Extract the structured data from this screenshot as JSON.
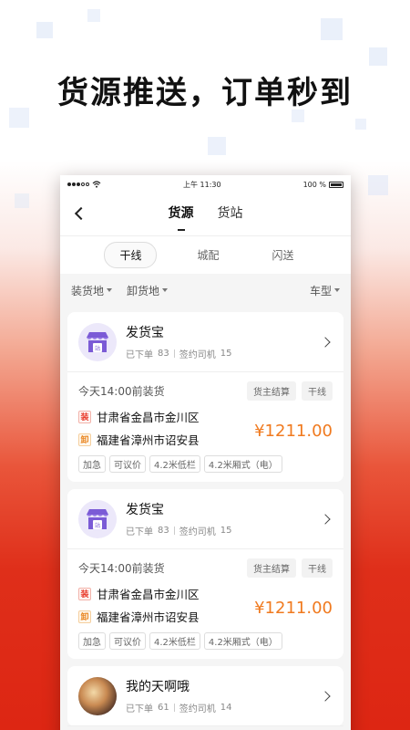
{
  "headline": "货源推送，订单秒到",
  "status_bar": {
    "time": "上午 11:30",
    "battery": "100 %"
  },
  "nav": {
    "tabs": [
      {
        "label": "货源",
        "active": true
      },
      {
        "label": "货站",
        "active": false
      }
    ]
  },
  "sub_tabs": [
    {
      "label": "干线",
      "active": true
    },
    {
      "label": "城配",
      "active": false
    },
    {
      "label": "闪送",
      "active": false
    }
  ],
  "filters": {
    "load_place": "装货地",
    "unload_place": "卸货地",
    "vehicle_type": "车型"
  },
  "cards": [
    {
      "name": "发货宝",
      "orders_label": "已下单",
      "orders": "83",
      "drivers_label": "签约司机",
      "drivers": "15",
      "avatar_icon": "store-icon",
      "load_time": "今天14:00前装货",
      "tags": [
        "货主结算",
        "干线"
      ],
      "load_mark": "装",
      "from": "甘肃省金昌市金川区",
      "unload_mark": "卸",
      "to": "福建省漳州市诏安县",
      "price": "¥1211.00",
      "features": [
        "加急",
        "可议价",
        "4.2米低栏",
        "4.2米厢式（电）"
      ]
    },
    {
      "name": "发货宝",
      "orders_label": "已下单",
      "orders": "83",
      "drivers_label": "签约司机",
      "drivers": "15",
      "avatar_icon": "store-icon",
      "load_time": "今天14:00前装货",
      "tags": [
        "货主结算",
        "干线"
      ],
      "load_mark": "装",
      "from": "甘肃省金昌市金川区",
      "unload_mark": "卸",
      "to": "福建省漳州市诏安县",
      "price": "¥1211.00",
      "features": [
        "加急",
        "可议价",
        "4.2米低栏",
        "4.2米厢式（电）"
      ]
    },
    {
      "name": "我的天啊哦",
      "orders_label": "已下单",
      "orders": "61",
      "drivers_label": "签约司机",
      "drivers": "14",
      "avatar_icon": "photo-avatar"
    }
  ],
  "colors": {
    "price": "#f07a1f",
    "load_mark": "#e83a2a",
    "unload_mark": "#e9851f",
    "store_icon": "#7b5bd6"
  }
}
